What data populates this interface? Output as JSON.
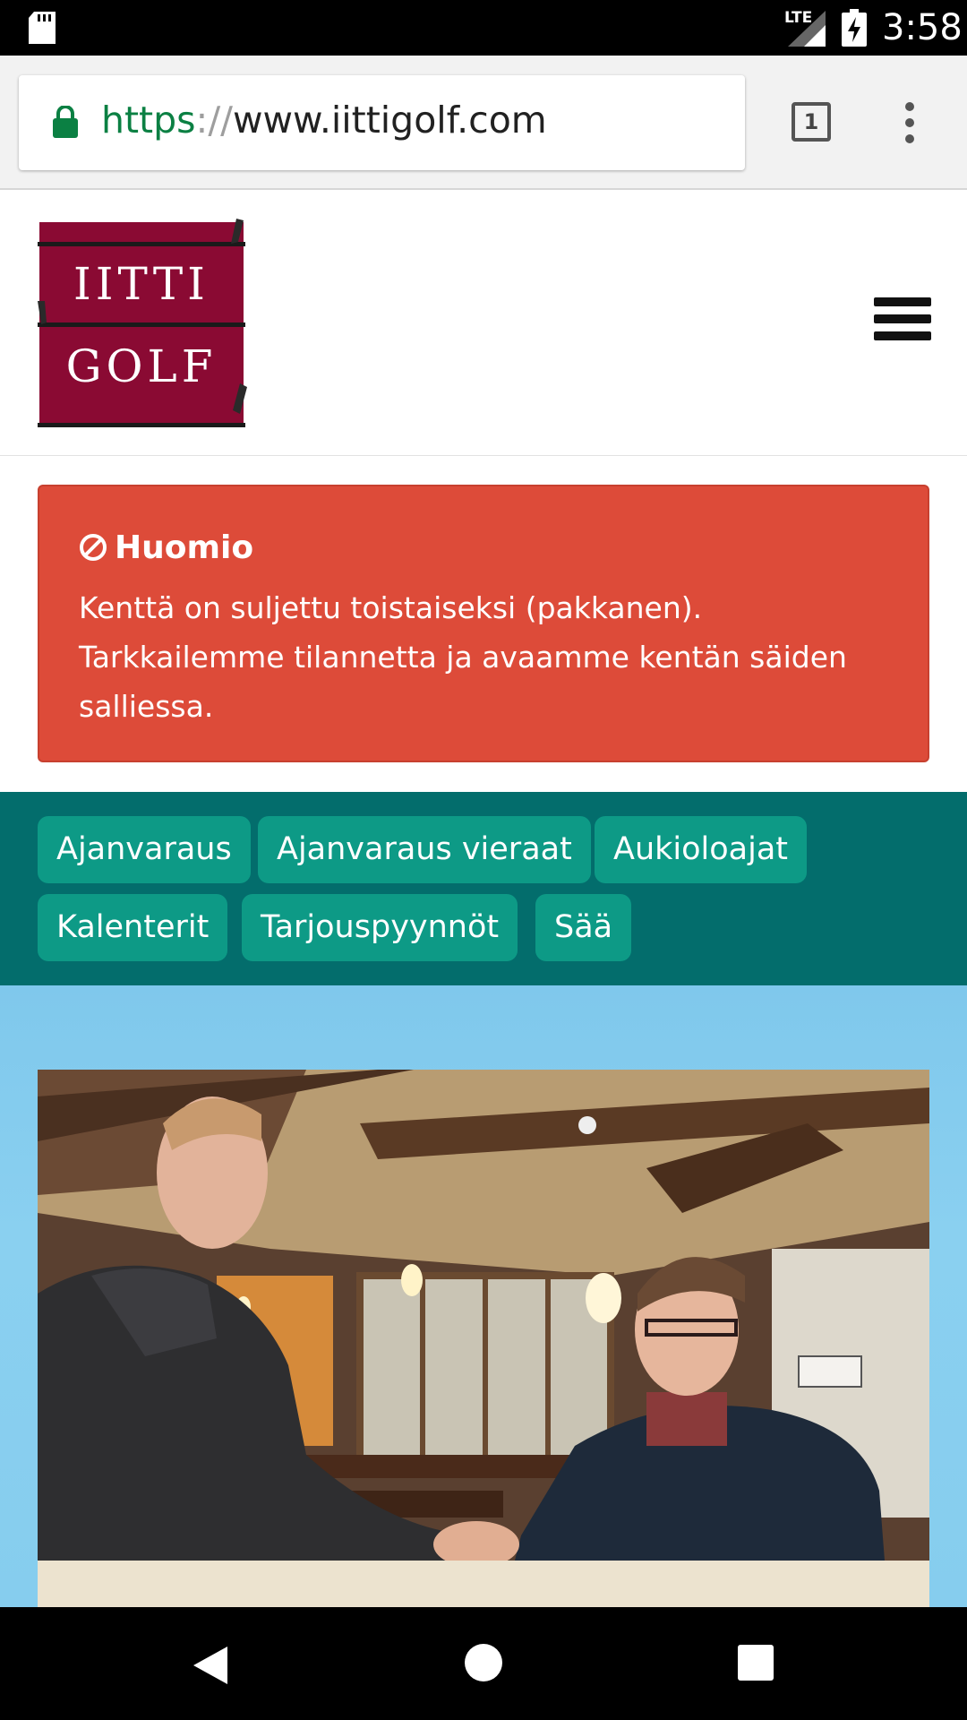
{
  "status_bar": {
    "network": "LTE",
    "time": "3:58"
  },
  "browser": {
    "url_scheme": "https",
    "url_sep": "://",
    "url_host": "www.iittigolf.com",
    "tab_count": "1"
  },
  "site": {
    "logo_line1": "IITTI",
    "logo_line2": "GOLF"
  },
  "alert": {
    "title": "Huomio",
    "body": "Kenttä on suljettu toistaiseksi (pakkanen). Tarkkailemme tilannetta ja avaamme kentän säiden salliessa."
  },
  "nav_pills": [
    "Ajanvaraus",
    "Ajanvaraus vieraat",
    "Aukioloajat",
    "Kalenterit",
    "Tarjouspyynnöt",
    "Sää"
  ],
  "colors": {
    "alert_bg": "#dd4b39",
    "nav_strip_bg": "#036d6c",
    "pill_bg": "#0d9a86",
    "logo_bg": "#8a0a33",
    "url_scheme": "#0b8043"
  }
}
